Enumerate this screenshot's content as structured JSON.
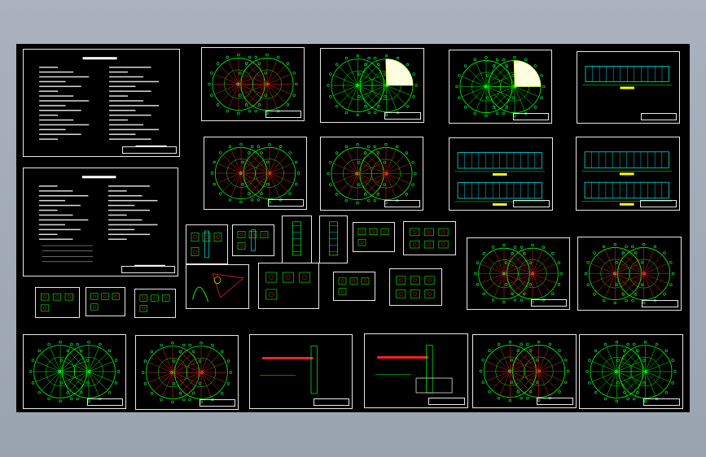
{
  "app": {
    "background": "#000000",
    "frame": "#9ea8b3"
  },
  "colors": {
    "line": "#00ff00",
    "axis": "#ff2020",
    "node": "#00ff66",
    "text": "#ffffff",
    "accent": "#ffff00",
    "border": "#e8e8e8",
    "cyan": "#00ffff"
  },
  "sheets": [
    {
      "id": "notes-1",
      "kind": "notes"
    },
    {
      "id": "notes-2",
      "kind": "notes-table"
    },
    {
      "id": "plan-a",
      "kind": "plan-double"
    },
    {
      "id": "plan-b",
      "kind": "plan-fan-yellow"
    },
    {
      "id": "plan-c",
      "kind": "plan-fan-yellow"
    },
    {
      "id": "elev-a",
      "kind": "elevation"
    },
    {
      "id": "plan-d",
      "kind": "plan-red"
    },
    {
      "id": "plan-e",
      "kind": "plan-red"
    },
    {
      "id": "elev-b",
      "kind": "elevation-2"
    },
    {
      "id": "elev-c",
      "kind": "elevation-2"
    },
    {
      "id": "small-1",
      "kind": "sym"
    },
    {
      "id": "small-2",
      "kind": "detail"
    },
    {
      "id": "small-3",
      "kind": "detail"
    },
    {
      "id": "det-1",
      "kind": "column"
    },
    {
      "id": "det-2",
      "kind": "column"
    },
    {
      "id": "det-3",
      "kind": "tall"
    },
    {
      "id": "det-4",
      "kind": "tall"
    },
    {
      "id": "det-5",
      "kind": "detail"
    },
    {
      "id": "det-6",
      "kind": "detail-grid"
    },
    {
      "id": "det-7",
      "kind": "stair"
    },
    {
      "id": "det-8",
      "kind": "detail"
    },
    {
      "id": "det-9",
      "kind": "detail"
    },
    {
      "id": "det-10",
      "kind": "detail-grid"
    },
    {
      "id": "plan-f",
      "kind": "plan-red"
    },
    {
      "id": "plan-g",
      "kind": "plan-red"
    },
    {
      "id": "plan-h",
      "kind": "plan-outline"
    },
    {
      "id": "plan-i",
      "kind": "plan-red"
    },
    {
      "id": "sect-a",
      "kind": "section"
    },
    {
      "id": "sect-b",
      "kind": "section-wide"
    },
    {
      "id": "plan-j",
      "kind": "plan-red"
    },
    {
      "id": "plan-k",
      "kind": "plan-roof"
    }
  ]
}
